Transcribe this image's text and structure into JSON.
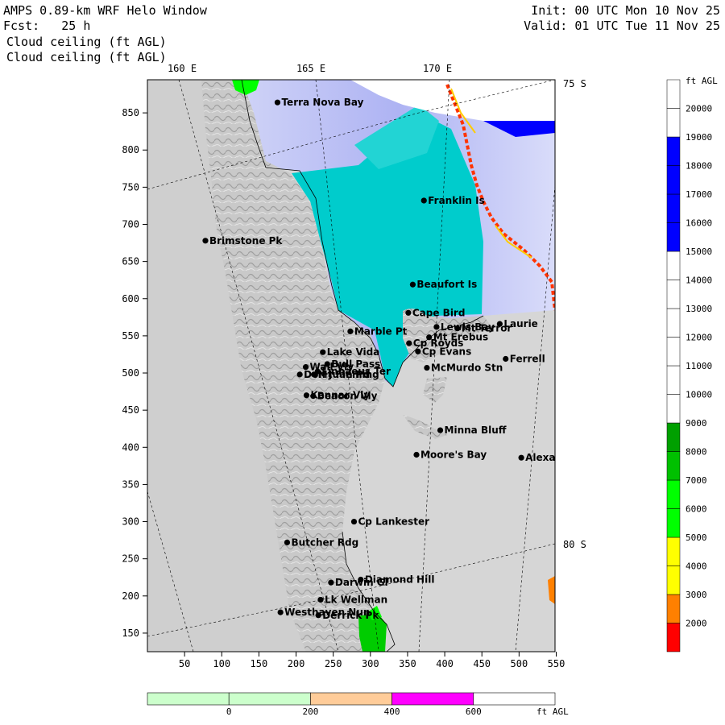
{
  "header": {
    "title": "AMPS 0.89-km WRF Helo Window",
    "forecast": "Fcst:   25 h",
    "field_line1": "Cloud ceiling (ft AGL)",
    "field_line2": "Cloud ceiling (ft AGL)",
    "init": "Init: 00 UTC Mon 10 Nov 25",
    "valid": "Valid: 01 UTC Tue 11 Nov 25"
  },
  "map": {
    "lon_labels": [
      "160 E",
      "165 E",
      "170 E"
    ],
    "lat_labels": [
      "75 S",
      "80 S"
    ],
    "x_ticks": [
      "50",
      "100",
      "150",
      "200",
      "250",
      "300",
      "350",
      "400",
      "450",
      "500",
      "550"
    ],
    "y_ticks": [
      "150",
      "200",
      "250",
      "300",
      "350",
      "400",
      "450",
      "500",
      "550",
      "600",
      "650",
      "700",
      "750",
      "800",
      "850"
    ],
    "places": [
      {
        "name": "Terra Nova Bay",
        "x": 175,
        "y": 864
      },
      {
        "name": "Franklin Is",
        "x": 372,
        "y": 732
      },
      {
        "name": "Brimstone Pk",
        "x": 78,
        "y": 678
      },
      {
        "name": "Beaufort Is",
        "x": 357,
        "y": 619
      },
      {
        "name": "Cape Bird",
        "x": 351,
        "y": 581
      },
      {
        "name": "Lewis Bay",
        "x": 389,
        "y": 562
      },
      {
        "name": "Laurie",
        "x": 474,
        "y": 566
      },
      {
        "name": "Mt Terror",
        "x": 417,
        "y": 560
      },
      {
        "name": "Marble Pt",
        "x": 273,
        "y": 556
      },
      {
        "name": "Mt Erebus",
        "x": 379,
        "y": 548
      },
      {
        "name": "Cp Royds",
        "x": 352,
        "y": 540
      },
      {
        "name": "Lake Vida",
        "x": 236,
        "y": 528
      },
      {
        "name": "Cp Evans",
        "x": 364,
        "y": 529
      },
      {
        "name": "Ferrell",
        "x": 482,
        "y": 519
      },
      {
        "name": "Wall Vly",
        "x": 213,
        "y": 508
      },
      {
        "name": "Bull Pass",
        "x": 242,
        "y": 512
      },
      {
        "name": "McMurdo Stn",
        "x": 376,
        "y": 507
      },
      {
        "name": "Don Juan Pd",
        "x": 205,
        "y": 498
      },
      {
        "name": "Mt Fleming",
        "x": 224,
        "y": 498
      },
      {
        "name": "Linnaeus Ter",
        "x": 229,
        "y": 502
      },
      {
        "name": "Kennar Vly",
        "x": 214,
        "y": 470
      },
      {
        "name": "Beacon Vly",
        "x": 223,
        "y": 469
      },
      {
        "name": "Minna Bluff",
        "x": 394,
        "y": 423
      },
      {
        "name": "Moore's Bay",
        "x": 362,
        "y": 390
      },
      {
        "name": "Alexander",
        "x": 503,
        "y": 386
      },
      {
        "name": "Cp Lankester",
        "x": 278,
        "y": 300
      },
      {
        "name": "Butcher Rdg",
        "x": 188,
        "y": 272
      },
      {
        "name": "Diamond Hill",
        "x": 287,
        "y": 222
      },
      {
        "name": "Darwin Gl",
        "x": 247,
        "y": 218
      },
      {
        "name": "Lk Wellman",
        "x": 233,
        "y": 195
      },
      {
        "name": "Westhaven Nun",
        "x": 179,
        "y": 178
      },
      {
        "name": "Derrick Pk",
        "x": 230,
        "y": 174
      }
    ]
  },
  "colorbar": {
    "unit": "ft AGL",
    "levels": [
      "2000",
      "3000",
      "4000",
      "5000",
      "6000",
      "7000",
      "8000",
      "9000",
      "10000",
      "11000",
      "12000",
      "13000",
      "14000",
      "15000",
      "16000",
      "17000",
      "18000",
      "19000",
      "20000"
    ],
    "colors": [
      "#ff0000",
      "#ff8000",
      "#ffff00",
      "#ffff00",
      "#00ff00",
      "#00ff00",
      "#00c000",
      "#00a000",
      "#ffffff",
      "#ffffff",
      "#ffffff",
      "#ffffff",
      "#ffffff",
      "#ffffff",
      "#0000ff",
      "#0000ff",
      "#0000ff",
      "#0000ff",
      "#ffffff"
    ]
  },
  "terrain_bar": {
    "unit": "ft AGL",
    "labels": [
      "0",
      "200",
      "400",
      "600"
    ],
    "colors": [
      "#ccffcc",
      "#ccffcc",
      "#ffcc99",
      "#ff00ff",
      "#ffffff"
    ]
  }
}
